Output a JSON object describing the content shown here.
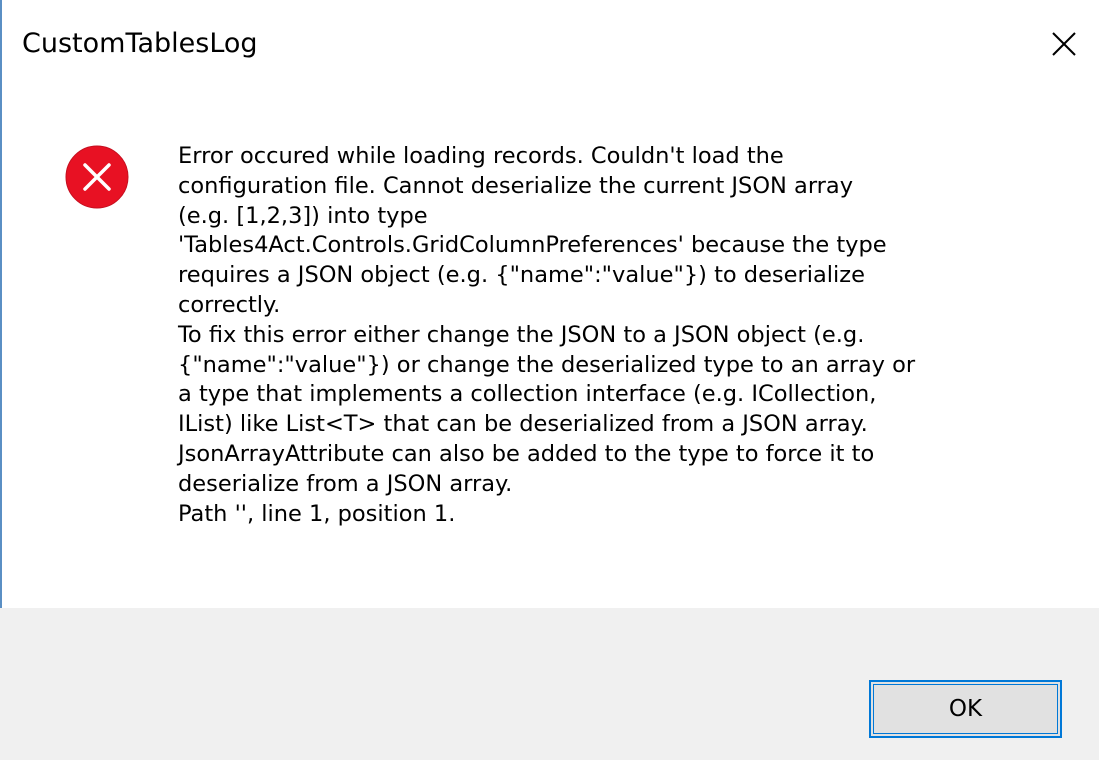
{
  "window": {
    "title": "CustomTablesLog",
    "close_icon": "close-icon"
  },
  "message": {
    "icon": "error-icon",
    "lines": [
      "Error occured while loading records. Couldn't load the",
      "configuration file. Cannot deserialize the current JSON array",
      "(e.g. [1,2,3]) into type",
      "'Tables4Act.Controls.GridColumnPreferences' because the type",
      "requires a JSON object (e.g. {\"name\":\"value\"}) to deserialize",
      "correctly.",
      "To fix this error either change the JSON to a JSON object (e.g.",
      "{\"name\":\"value\"}) or change the deserialized type to an array or",
      "a type that implements a collection interface (e.g. ICollection,",
      "IList) like List<T> that can be deserialized from a JSON array.",
      "JsonArrayAttribute can also be added to the type to force it to",
      "deserialize from a JSON array.",
      "Path '', line 1, position 1."
    ]
  },
  "footer": {
    "ok_label": "OK"
  },
  "colors": {
    "accent": "#0078d7",
    "error_red": "#e81123",
    "footer_bg": "#f0f0f0"
  }
}
